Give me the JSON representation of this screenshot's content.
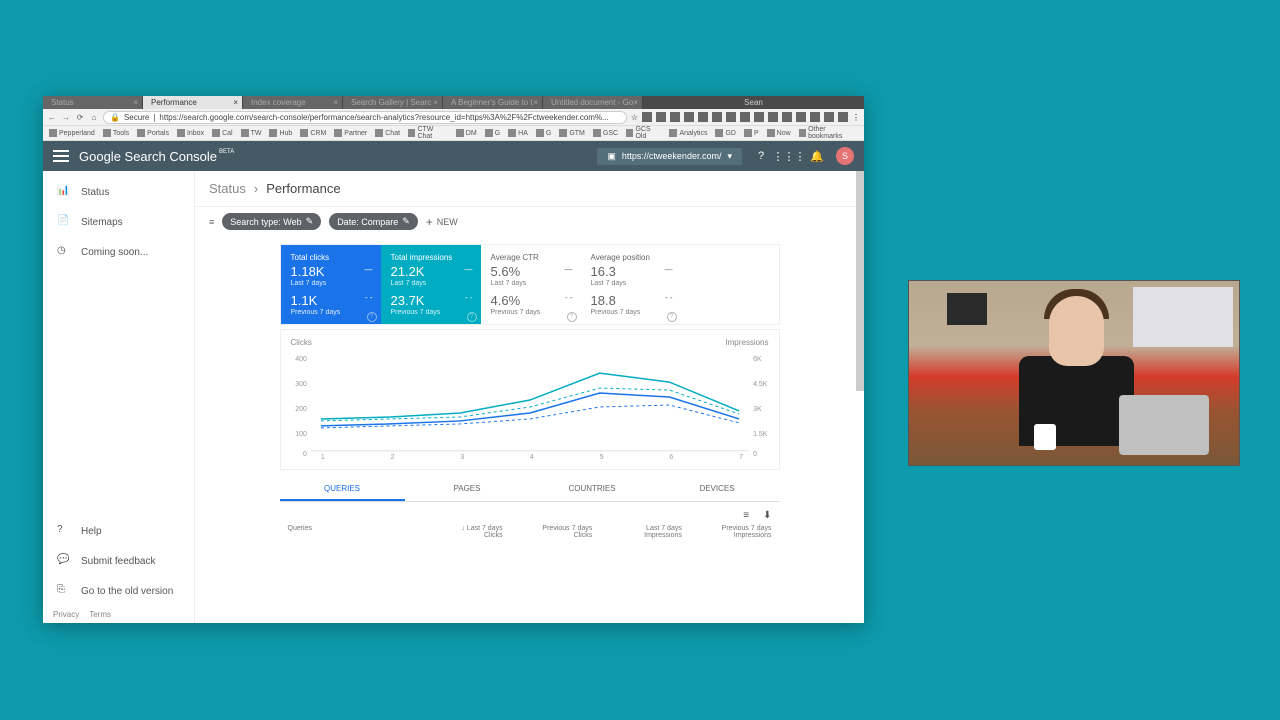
{
  "browser": {
    "tabs": [
      "Status",
      "Performance",
      "Index coverage",
      "Search Gallery | Searc",
      "A Beginner's Guide to t",
      "Untitled document - Go"
    ],
    "active_tab": 1,
    "spacer_label": "Sean",
    "nav": {
      "back": "←",
      "forward": "→",
      "reload": "⟳",
      "home": "⌂"
    },
    "secure_label": "Secure",
    "url": "https://search.google.com/search-console/performance/search-analytics?resource_id=https%3A%2F%2Fctweekender.com%...",
    "star": "☆",
    "menu": "⋮"
  },
  "bookmarks": [
    "Pepperland",
    "Tools",
    "Portals",
    "Inbox",
    "Cal",
    "TW",
    "Hub",
    "CRM",
    "Partner",
    "Chat",
    "CTW Chat",
    "DM",
    "G",
    "HA",
    "G",
    "GTM",
    "GSC",
    "GCS Old",
    "Analytics",
    "GD",
    "P",
    "Now",
    "Other bookmarks"
  ],
  "header": {
    "title": "Google Search Console",
    "beta": "BETA",
    "property": "https://ctweekender.com/",
    "avatar_letter": "S"
  },
  "sidebar": {
    "items": [
      {
        "label": "Status"
      },
      {
        "label": "Sitemaps"
      },
      {
        "label": "Coming soon..."
      }
    ],
    "help": "Help",
    "feedback": "Submit feedback",
    "old_version": "Go to the old version",
    "privacy": "Privacy",
    "terms": "Terms"
  },
  "breadcrumb": {
    "status": "Status",
    "current": "Performance"
  },
  "filters": {
    "search_type": "Search type: Web",
    "date": "Date: Compare",
    "new": "NEW"
  },
  "metrics": [
    {
      "title": "Total clicks",
      "v1": "1.18K",
      "s1": "Last 7 days",
      "v2": "1.1K",
      "s2": "Previous 7 days",
      "d1": "—",
      "d2": "- -"
    },
    {
      "title": "Total impressions",
      "v1": "21.2K",
      "s1": "Last 7 days",
      "v2": "23.7K",
      "s2": "Previous 7 days",
      "d1": "—",
      "d2": "- -"
    },
    {
      "title": "Average CTR",
      "v1": "5.6%",
      "s1": "Last 7 days",
      "v2": "4.6%",
      "s2": "Previous 7 days",
      "d1": "—",
      "d2": "- -"
    },
    {
      "title": "Average position",
      "v1": "16.3",
      "s1": "Last 7 days",
      "v2": "18.8",
      "s2": "Previous 7 days",
      "d1": "—",
      "d2": "- -"
    }
  ],
  "chart_data": {
    "type": "line",
    "left_label": "Clicks",
    "right_label": "Impressions",
    "x": [
      1,
      2,
      3,
      4,
      5,
      6,
      7
    ],
    "y_left_ticks": [
      0,
      100,
      200,
      300,
      400
    ],
    "y_right_ticks": [
      0,
      "1.5K",
      "3K",
      "4.5K",
      "6K"
    ],
    "series": [
      {
        "name": "Clicks Last 7 days",
        "axis": "left",
        "style": "solid-blue",
        "values": [
          100,
          110,
          120,
          155,
          235,
          220,
          130
        ]
      },
      {
        "name": "Clicks Previous 7 days",
        "axis": "left",
        "style": "dashed-blue",
        "values": [
          95,
          100,
          110,
          130,
          180,
          190,
          120
        ]
      },
      {
        "name": "Impressions Last 7 days",
        "axis": "right",
        "style": "solid-teal",
        "values": [
          2000,
          2100,
          2300,
          3100,
          4700,
          4200,
          2500
        ]
      },
      {
        "name": "Impressions Previous 7 days",
        "axis": "right",
        "style": "dashed-teal",
        "values": [
          1900,
          2000,
          2100,
          2700,
          3800,
          3700,
          2300
        ]
      }
    ]
  },
  "table_tabs": [
    "QUERIES",
    "PAGES",
    "COUNTRIES",
    "DEVICES"
  ],
  "table": {
    "filter_icon": "≡",
    "download_icon": "⬇",
    "col_hdr": "Queries",
    "sort_arrow": "↓",
    "cols": [
      {
        "l1": "Last 7 days",
        "l2": "Clicks"
      },
      {
        "l1": "Previous 7 days",
        "l2": "Clicks"
      },
      {
        "l1": "Last 7 days",
        "l2": "Impressions"
      },
      {
        "l1": "Previous 7 days",
        "l2": "Impressions"
      }
    ]
  }
}
